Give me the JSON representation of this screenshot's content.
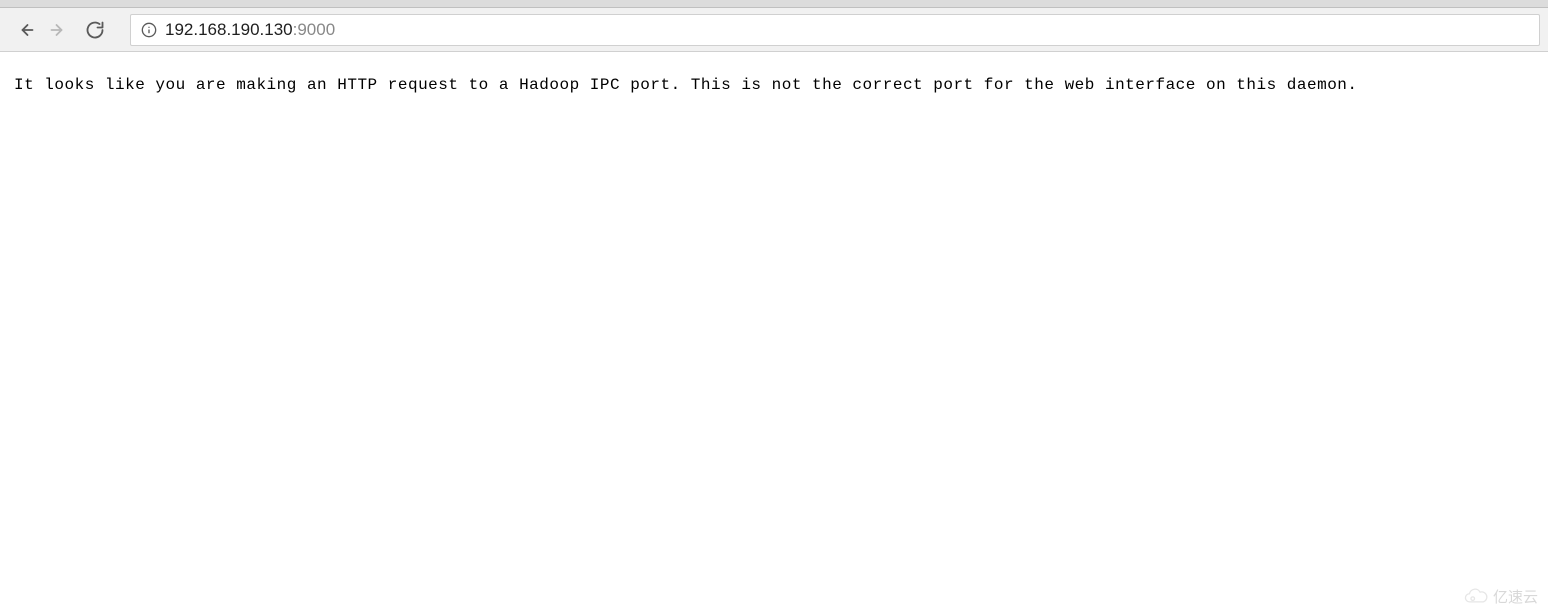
{
  "address": {
    "host": "192.168.190.130",
    "port": ":9000"
  },
  "page": {
    "message": "It looks like you are making an HTTP request to a Hadoop IPC port. This is not the correct port for the web interface on this daemon."
  },
  "watermark": {
    "text": "亿速云"
  }
}
